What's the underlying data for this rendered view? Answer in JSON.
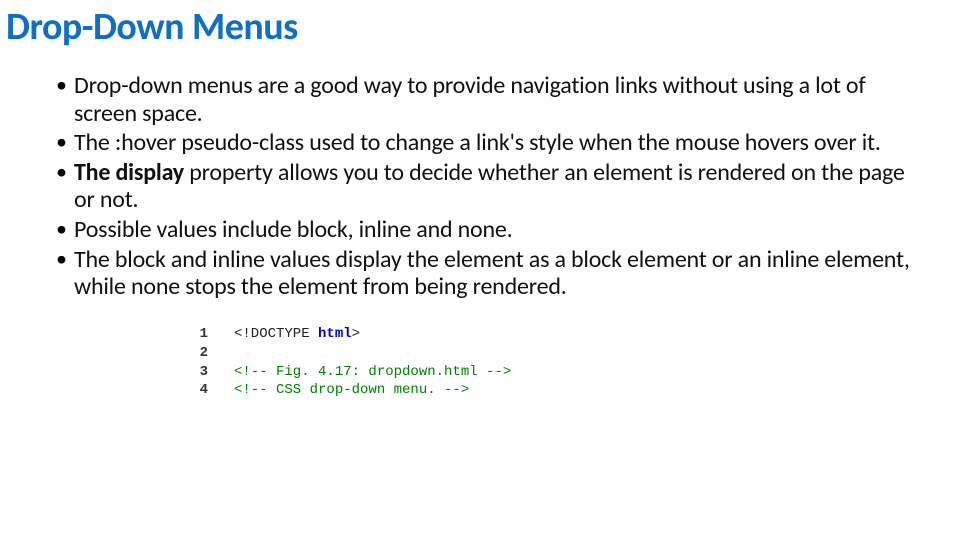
{
  "title": "Drop-Down Menus",
  "bullets": [
    {
      "pre": "",
      "bold": "",
      "post": "Drop-down menus are a good way to provide navigation links without using a lot of screen space."
    },
    {
      "pre": "",
      "bold": "",
      "post": "The :hover pseudo-class used to change a link's style when the mouse hovers over it."
    },
    {
      "pre": "",
      "bold": "The display",
      "post": " property allows you to decide whether an element is rendered on the page or not."
    },
    {
      "pre": "",
      "bold": "",
      "post": "Possible values include block, inline and none."
    },
    {
      "pre": "",
      "bold": "",
      "post": "The block and inline values display the element as a block element or an inline element, while none stops the element from being rendered."
    }
  ],
  "code": {
    "lines": [
      {
        "n": "1",
        "doctype_open": "<!DOCTYPE ",
        "doctype_kw": "html",
        "doctype_close": ">"
      },
      {
        "n": "2",
        "blank": " "
      },
      {
        "n": "3",
        "comment": "<!-- Fig. 4.17: dropdown.html -->"
      },
      {
        "n": "4",
        "comment": "<!-- CSS drop-down menu. -->"
      }
    ]
  }
}
